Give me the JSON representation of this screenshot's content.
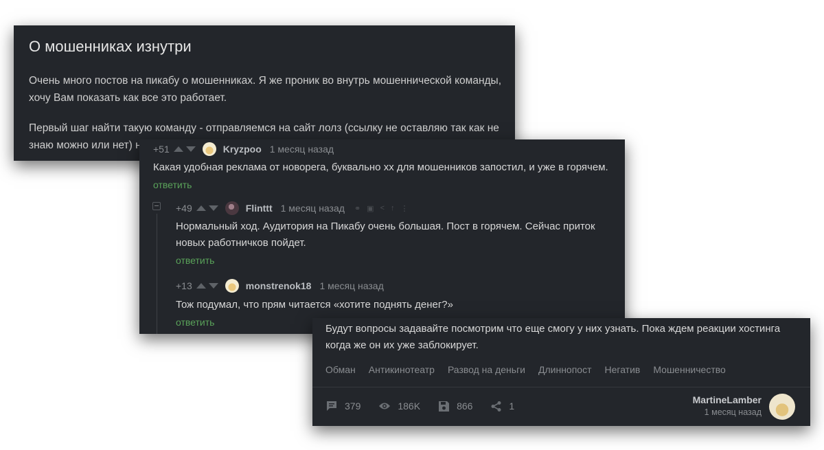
{
  "post": {
    "title": "О мошенниках изнутри",
    "paragraph1_line1": "Очень много постов на пикабу о мошенниках. Я же проник во внутрь мошеннической команды,",
    "paragraph1_line2": "хочу Вам показать как все это работает.",
    "paragraph2_line1": "Первый шаг найти такую команду - отправляемся на сайт лолз (ссылку не оставляю так как не",
    "paragraph2_line2": "знаю можно или нет) н"
  },
  "comments": [
    {
      "rating": "+51",
      "author": "Kryzpoo",
      "time": "1 месяц назад",
      "text_line1": "Какая удобная реклама от новорега, буквально хх для мошенников запостил, и уже в горячем.",
      "reply": "ответить"
    },
    {
      "rating": "+49",
      "author": "Flinttt",
      "time": "1 месяц назад",
      "text_line1": "Нормальный ход. Аудитория на Пикабу очень большая. Пост в горячем. Сейчас приток",
      "text_line2": "новых работничков пойдет.",
      "reply": "ответить"
    },
    {
      "rating": "+13",
      "author": "monstrenok18",
      "time": "1 месяц назад",
      "text_line1": "Тож подумал, что прям читается «хотите поднять денег?»",
      "reply": "ответить"
    }
  ],
  "post_footer": {
    "text_line1": "Будут вопросы задавайте  посмотрим что еще смогу у них узнать. Пока ждем реакции хостинга",
    "text_line2": "когда же он их уже заблокирует.",
    "tags": [
      "Обман",
      "Антикинотеатр",
      "Развод на деньги",
      "Длиннопост",
      "Негатив",
      "Мошенничество"
    ],
    "stats": {
      "comments": "379",
      "views": "186K",
      "saves": "866",
      "shares": "1"
    },
    "author": "MartineLamber",
    "time": "1 месяц назад"
  },
  "icons": {
    "vote_up": "triangle-up-icon",
    "vote_down": "triangle-down-icon",
    "comments": "comment-icon",
    "views": "eye-icon",
    "saves": "save-icon",
    "share": "share-icon"
  },
  "colors": {
    "card_bg": "#23262b",
    "reply_link": "#5aa35a",
    "muted_text": "#8a8d91"
  }
}
